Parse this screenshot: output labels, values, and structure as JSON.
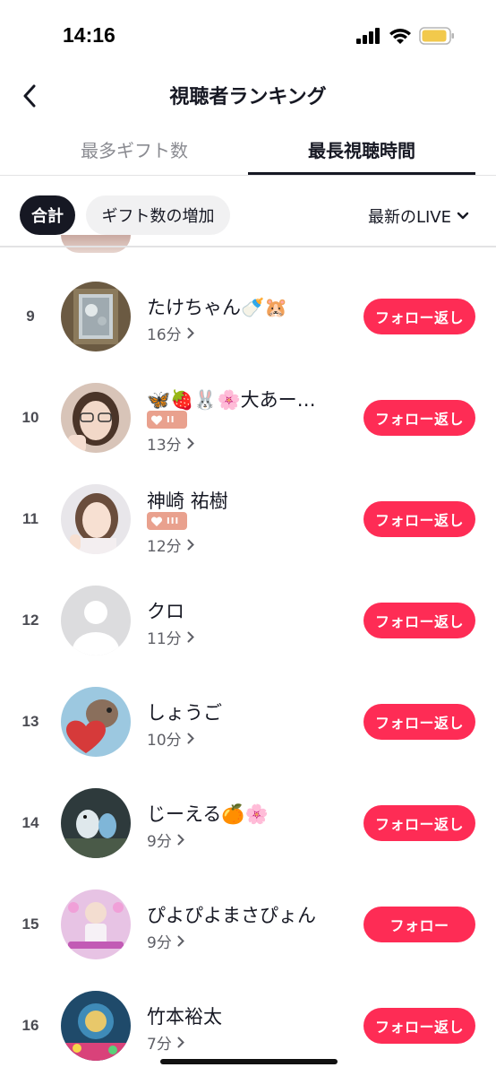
{
  "status_bar": {
    "time": "14:16"
  },
  "header": {
    "title": "視聴者ランキング"
  },
  "tabs": [
    {
      "label": "最多ギフト数",
      "active": false
    },
    {
      "label": "最長視聴時間",
      "active": true
    }
  ],
  "filters": {
    "total_label": "合計",
    "increase_label": "ギフト数の増加",
    "sort_label": "最新のLIVE"
  },
  "viewers": [
    {
      "rank": "9",
      "name": "たけちゃん🍼🐹",
      "badge": "",
      "duration": "16分",
      "button": "フォロー返し",
      "avatar": "photo-window"
    },
    {
      "rank": "10",
      "name": "🦋🍓🐰🌸大あー…",
      "badge": "II",
      "duration": "13分",
      "button": "フォロー返し",
      "avatar": "photo-girl-glasses"
    },
    {
      "rank": "11",
      "name": "神崎 祐樹",
      "badge": "III",
      "duration": "12分",
      "button": "フォロー返し",
      "avatar": "photo-girl-peace"
    },
    {
      "rank": "12",
      "name": "クロ",
      "badge": "",
      "duration": "11分",
      "button": "フォロー返し",
      "avatar": "default-user"
    },
    {
      "rank": "13",
      "name": "しょうご",
      "badge": "",
      "duration": "10分",
      "button": "フォロー返し",
      "avatar": "photo-otter-heart"
    },
    {
      "rank": "14",
      "name": "じーえる🍊🌸",
      "badge": "",
      "duration": "9分",
      "button": "フォロー返し",
      "avatar": "photo-birds"
    },
    {
      "rank": "15",
      "name": "ぴよぴよまさぴょん",
      "badge": "",
      "duration": "9分",
      "button": "フォロー",
      "avatar": "photo-pink-stage"
    },
    {
      "rank": "16",
      "name": "竹本裕太",
      "badge": "",
      "duration": "7分",
      "button": "フォロー返し",
      "avatar": "photo-aquarium"
    }
  ],
  "colors": {
    "accent": "#fe2c55",
    "text": "#161823",
    "muted": "#8a8b91",
    "badge": "#e9a18e"
  }
}
